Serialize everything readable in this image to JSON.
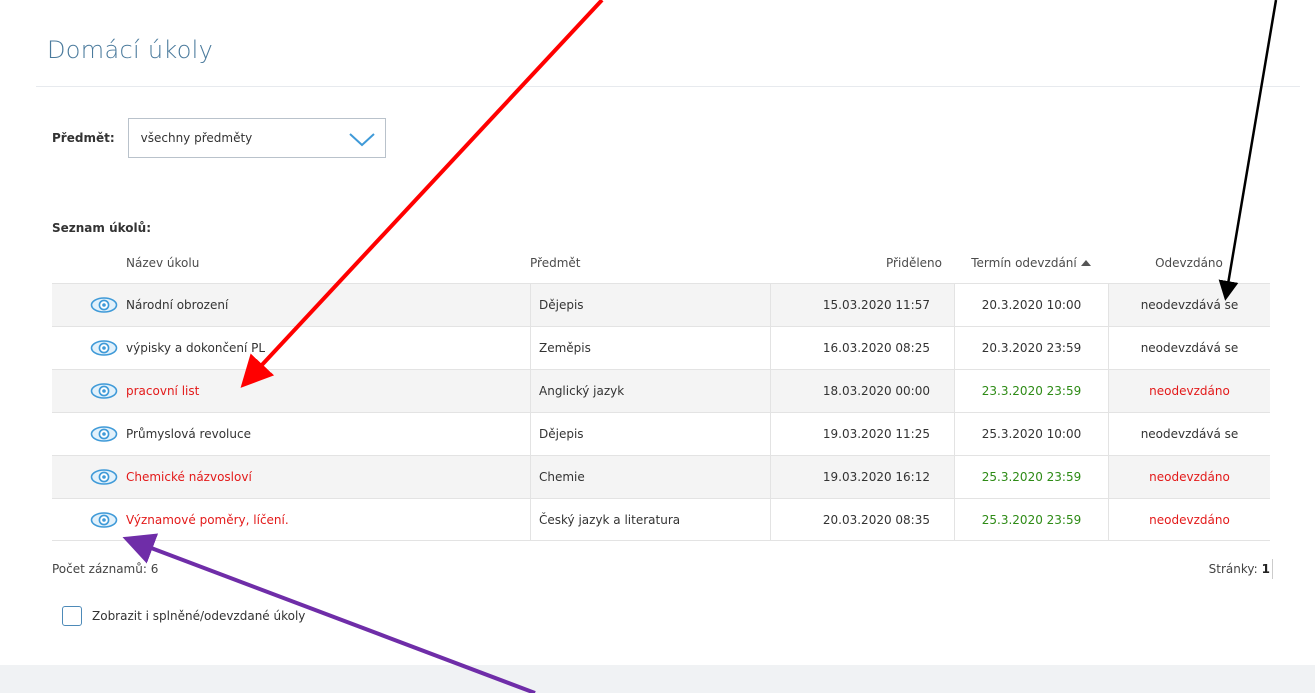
{
  "page": {
    "title": "Domácí úkoly"
  },
  "filter": {
    "label": "Předmět:",
    "selected": "všechny předměty"
  },
  "list": {
    "label": "Seznam úkolů:",
    "columns": {
      "name": "Název úkolu",
      "subject": "Předmět",
      "assigned": "Přiděleno",
      "due": "Termín odevzdání",
      "submitted": "Odevzdáno"
    },
    "rows": [
      {
        "name": "Národní obrození",
        "subject": "Dějepis",
        "assigned": "15.03.2020 11:57",
        "due": "20.3.2020 10:00",
        "submitted": "neodevzdává se",
        "name_color": "#333333",
        "due_color": "#333333",
        "submitted_color": "#333333"
      },
      {
        "name": "výpisky a dokončení PL",
        "subject": "Zeměpis",
        "assigned": "16.03.2020 08:25",
        "due": "20.3.2020 23:59",
        "submitted": "neodevzdává se",
        "name_color": "#333333",
        "due_color": "#333333",
        "submitted_color": "#333333"
      },
      {
        "name": "pracovní list",
        "subject": "Anglický jazyk",
        "assigned": "18.03.2020 00:00",
        "due": "23.3.2020 23:59",
        "submitted": "neodevzdáno",
        "name_color": "#e31a1a",
        "due_color": "#2e8b16",
        "submitted_color": "#e31a1a"
      },
      {
        "name": "Průmyslová revoluce",
        "subject": "Dějepis",
        "assigned": "19.03.2020 11:25",
        "due": "25.3.2020 10:00",
        "submitted": "neodevzdává se",
        "name_color": "#333333",
        "due_color": "#333333",
        "submitted_color": "#333333"
      },
      {
        "name": "Chemické názvosloví",
        "subject": "Chemie",
        "assigned": "19.03.2020 16:12",
        "due": "25.3.2020 23:59",
        "submitted": "neodevzdáno",
        "name_color": "#e31a1a",
        "due_color": "#2e8b16",
        "submitted_color": "#e31a1a"
      },
      {
        "name": "Významové poměry, líčení.",
        "subject": "Český jazyk a literatura",
        "assigned": "20.03.2020 08:35",
        "due": "25.3.2020 23:59",
        "submitted": "neodevzdáno",
        "name_color": "#e31a1a",
        "due_color": "#2e8b16",
        "submitted_color": "#e31a1a"
      }
    ],
    "record_count": "Počet záznamů: 6",
    "pages_label": "Stránky:",
    "pages_value": "1",
    "show_completed_label": "Zobrazit i splněné/odevzdané úkoly"
  },
  "colors": {
    "accent": "#4a7a9c",
    "eye_icon": "#3f9ad8",
    "red": "#e31a1a",
    "green": "#2e8b16"
  },
  "icons": {
    "row_view": "eye-icon",
    "select": "chevron-down-icon",
    "sort": "sort-ascending-icon"
  }
}
